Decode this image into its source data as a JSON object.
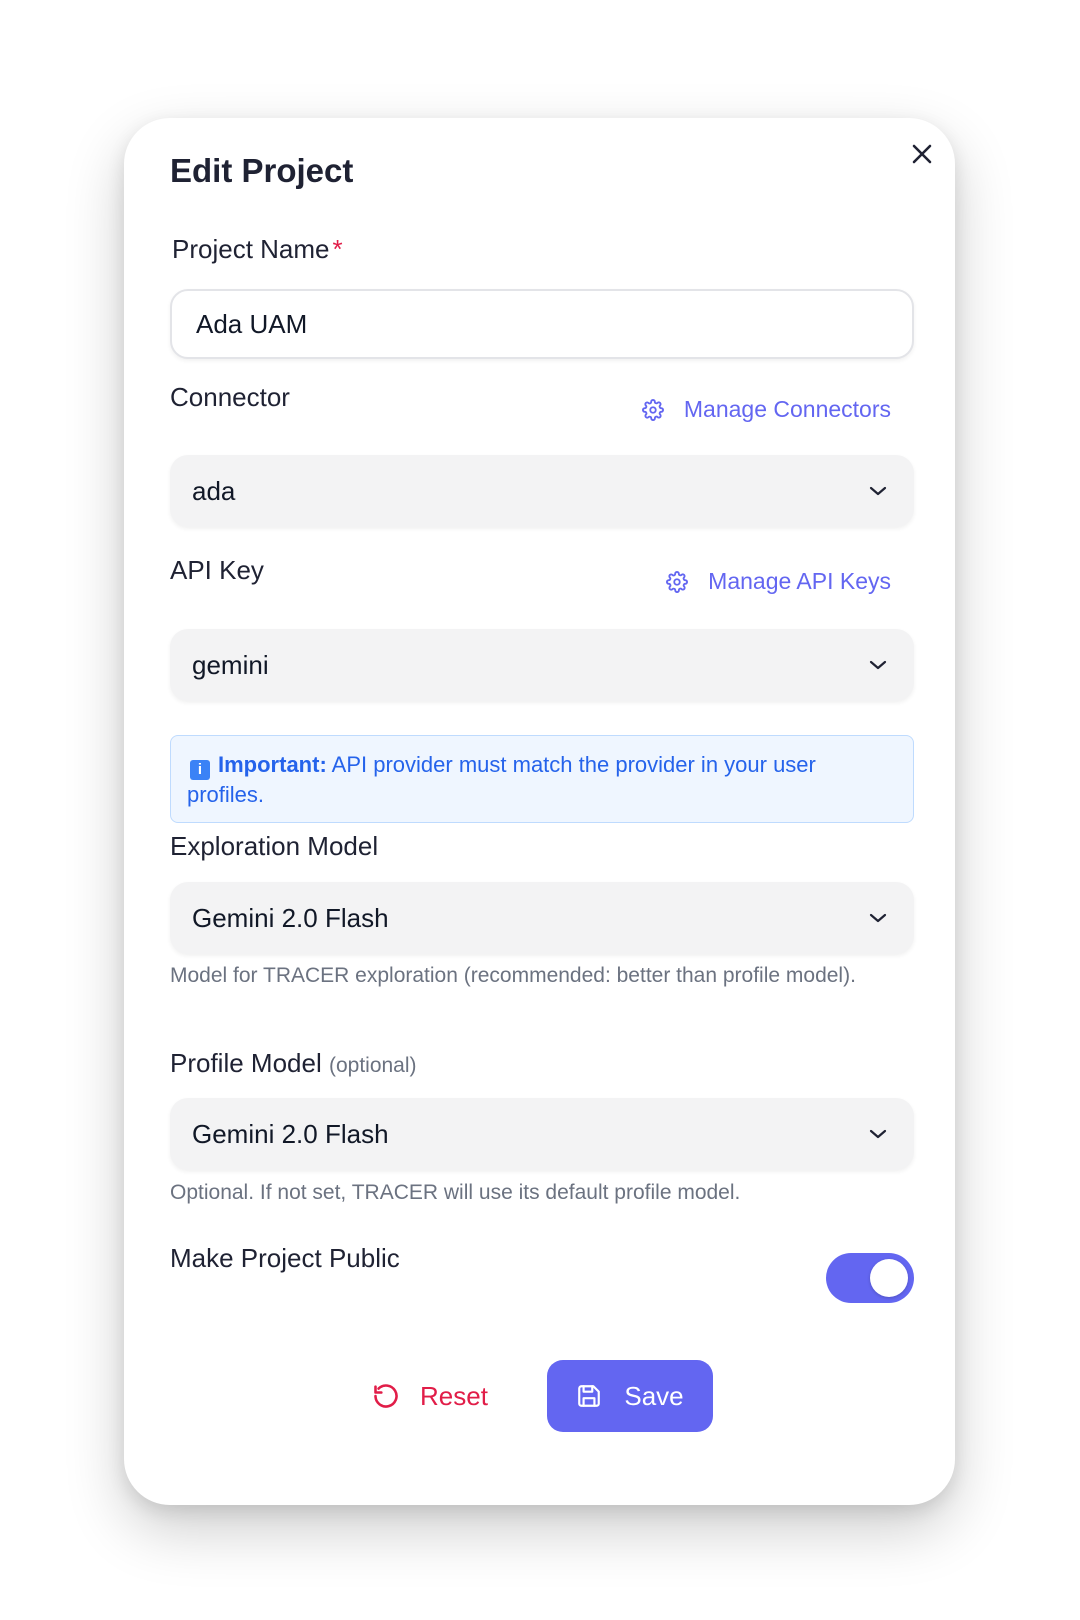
{
  "modal": {
    "title": "Edit Project",
    "close_icon": "close-icon"
  },
  "project_name": {
    "label": "Project Name",
    "required_mark": "*",
    "value": "Ada UAM"
  },
  "connector": {
    "label": "Connector",
    "manage_label": "Manage Connectors",
    "manage_icon": "gear-icon",
    "selected": "ada"
  },
  "api_key": {
    "label": "API Key",
    "manage_label": "Manage API Keys",
    "manage_icon": "gear-icon",
    "selected": "gemini"
  },
  "notice": {
    "icon": "info-icon",
    "icon_glyph": "i",
    "title": "Important:",
    "text": " API provider must match the provider in your user profiles."
  },
  "exploration_model": {
    "label": "Exploration Model",
    "selected": "Gemini 2.0 Flash",
    "help": "Model for TRACER exploration (recommended: better than profile model)."
  },
  "profile_model": {
    "label": "Profile Model",
    "optional_tag": "(optional)",
    "selected": "Gemini 2.0 Flash",
    "help": "Optional. If not set, TRACER will use its default profile model."
  },
  "make_public": {
    "label": "Make Project Public",
    "enabled": true
  },
  "actions": {
    "reset_label": "Reset",
    "reset_icon": "undo-icon",
    "save_label": "Save",
    "save_icon": "floppy-disk-icon"
  },
  "colors": {
    "accent": "#6366f1",
    "danger": "#e11d48",
    "info": "#2563eb",
    "info_bg": "#eff6ff"
  }
}
